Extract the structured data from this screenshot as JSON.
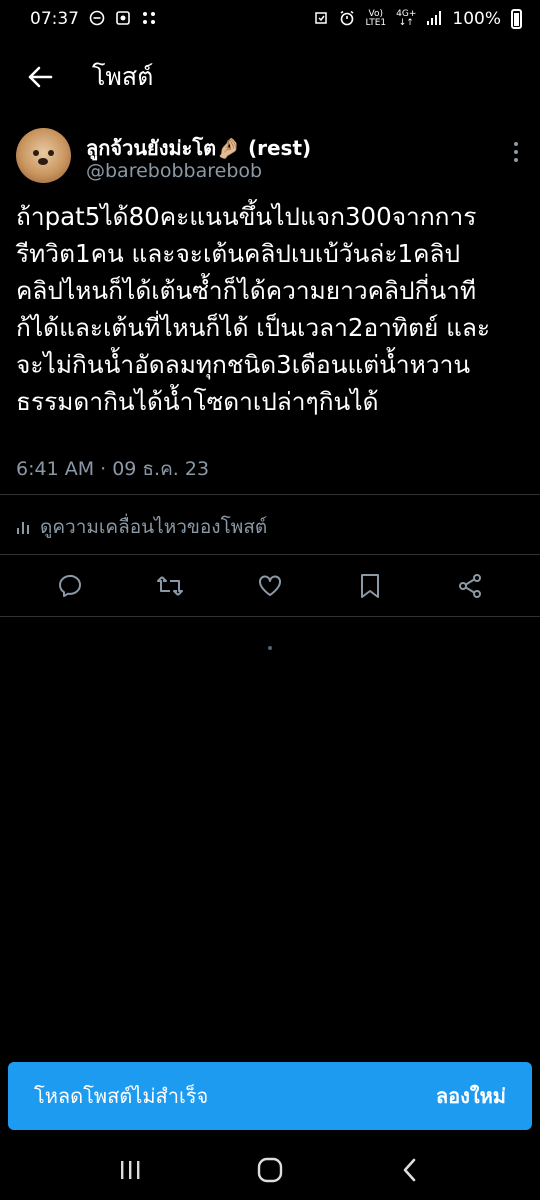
{
  "status_bar": {
    "time": "07:37",
    "network_top": "Vo)",
    "network_bottom": "LTE1",
    "network2_top": "4G+",
    "network2_bottom": "↓↑",
    "battery": "100%"
  },
  "header": {
    "title": "โพสต์"
  },
  "tweet": {
    "author_name": "ลูกจ้วนยังม่ะโต🤌🏼 (rest)",
    "handle": "@barebobbarebob",
    "text": "ถ้าpat5ได้80คะแนนขึ้นไปแจก300จากการ\nรีทวิต1คน  และจะเต้นคลิปเบเบ้วันล่ะ1คลิป\nคลิปไหนก็ได้เต้นซ้ำก็ได้ความยาวคลิปกี่นาที\nก้ได้และเต้นที่ไหนก็ได้ เป็นเวลา2อาทิตย์ และ\nจะไม่กินน้ำอัดลมทุกชนิด3เดือนแต่น้ำหวาน\nธรรมดากินได้น้ำโซดาเปล่าๆกินได้",
    "timestamp": "6:41 AM · 09 ธ.ค. 23",
    "engagement_label": "ดูความเคลื่อนไหวของโพสต์"
  },
  "actions": [
    "reply-icon",
    "retweet-icon",
    "like-icon",
    "bookmark-icon",
    "share-icon"
  ],
  "toast": {
    "message": "โหลดโพสต์ไม่สำเร็จ",
    "retry": "ลองใหม่"
  },
  "colors": {
    "background": "#000000",
    "accent": "#1d9bf0",
    "secondary_text": "#8b98a5",
    "divider": "#2f3336"
  }
}
